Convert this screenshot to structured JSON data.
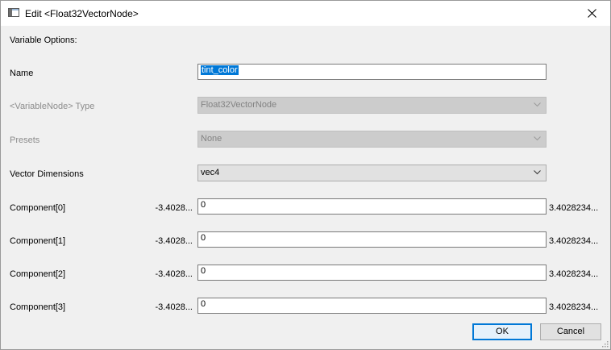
{
  "window": {
    "title": "Edit <Float32VectorNode>",
    "close_icon": "close-icon",
    "app_icon": "window-app-icon"
  },
  "form": {
    "section_heading": "Variable Options:",
    "name": {
      "label": "Name",
      "value": "tint_color"
    },
    "type": {
      "label": "<VariableNode> Type",
      "value": "Float32VectorNode",
      "enabled": false
    },
    "presets": {
      "label": "Presets",
      "value": "None",
      "enabled": false
    },
    "dimensions": {
      "label": "Vector Dimensions",
      "value": "vec4",
      "enabled": true
    },
    "components": [
      {
        "label": "Component[0]",
        "min": "-3.4028...",
        "value": "0",
        "max": "3.4028234..."
      },
      {
        "label": "Component[1]",
        "min": "-3.4028...",
        "value": "0",
        "max": "3.4028234..."
      },
      {
        "label": "Component[2]",
        "min": "-3.4028...",
        "value": "0",
        "max": "3.4028234..."
      },
      {
        "label": "Component[3]",
        "min": "-3.4028...",
        "value": "0",
        "max": "3.4028234..."
      }
    ]
  },
  "buttons": {
    "ok": "OK",
    "cancel": "Cancel"
  },
  "colors": {
    "selection": "#0078d7",
    "dialog_bg": "#f0f0f0",
    "disabled_text": "#8c8c8c"
  }
}
